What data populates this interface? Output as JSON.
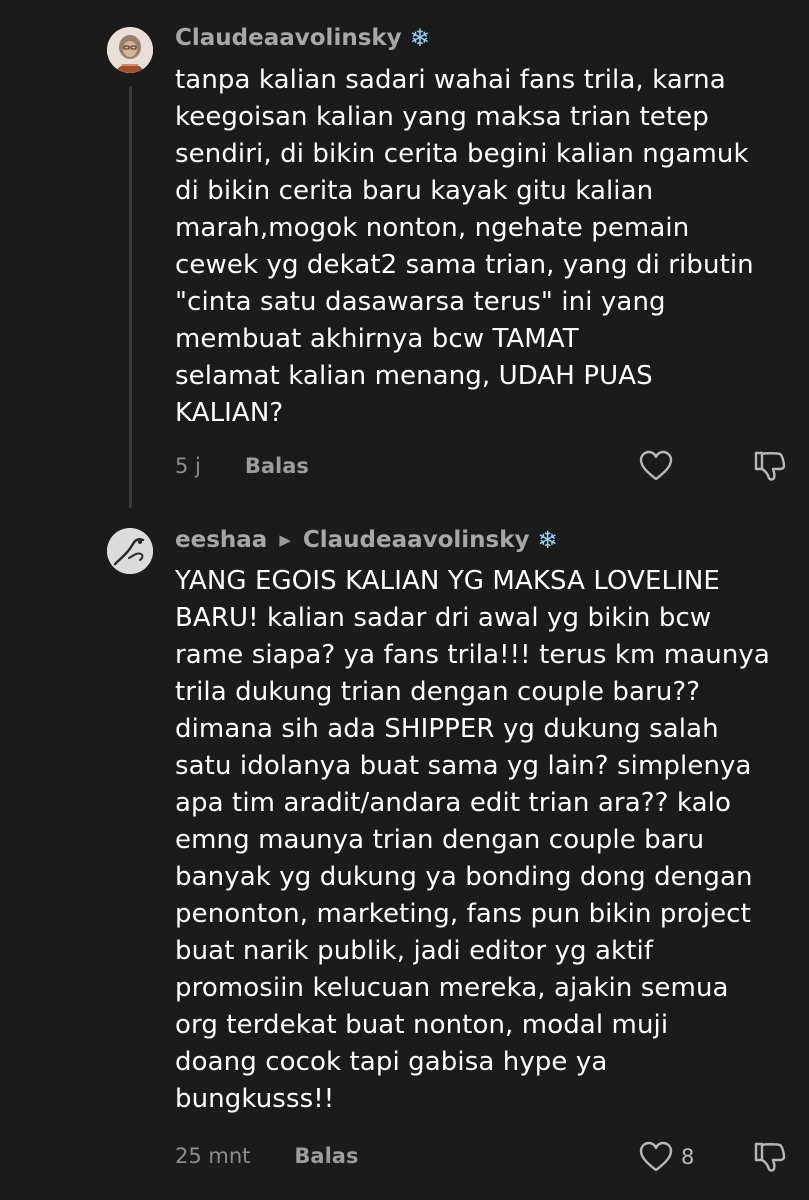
{
  "comments": [
    {
      "username": "Claudeaavolinsky",
      "badge_icon": "snowflake-icon",
      "text": "tanpa kalian sadari wahai fans trila, karna\nkeegoisan kalian yang maksa trian tetep\nsendiri, di bikin cerita begini kalian ngamuk\ndi bikin cerita baru kayak gitu kalian\nmarah,mogok nonton, ngehate pemain\ncewek yg dekat2 sama trian, yang di ributin\n\"cinta satu dasawarsa terus\" ini yang\nmembuat akhirnya bcw TAMAT\nselamat kalian menang, UDAH PUAS\nKALIAN?",
      "time": "5 j",
      "reply_label": "Balas",
      "like_count": ""
    },
    {
      "username": "eeshaa",
      "reply_to": "Claudeaavolinsky",
      "badge_icon": "snowflake-icon",
      "text": "YANG EGOIS KALIAN YG MAKSA LOVELINE\nBARU! kalian sadar dri awal yg bikin bcw\nrame siapa? ya fans trila!!! terus km maunya\ntrila dukung trian dengan couple baru??\ndimana sih ada SHIPPER yg dukung salah\nsatu idolanya buat sama yg lain? simplenya\napa tim aradit/andara edit trian ara?? kalo\nemng maunya trian dengan couple baru\nbanyak yg dukung ya bonding dong dengan\npenonton, marketing, fans pun bikin project\nbuat narik publik, jadi editor yg aktif\npromosiin kelucuan mereka, ajakin semua\norg terdekat buat nonton, modal muji\ndoang cocok tapi gabisa hype ya\nbungkusss!!",
      "time": "25 mnt",
      "reply_label": "Balas",
      "like_count": "8"
    }
  ],
  "icons": {
    "snowflake": "❄",
    "reply_arrow": "▶"
  }
}
